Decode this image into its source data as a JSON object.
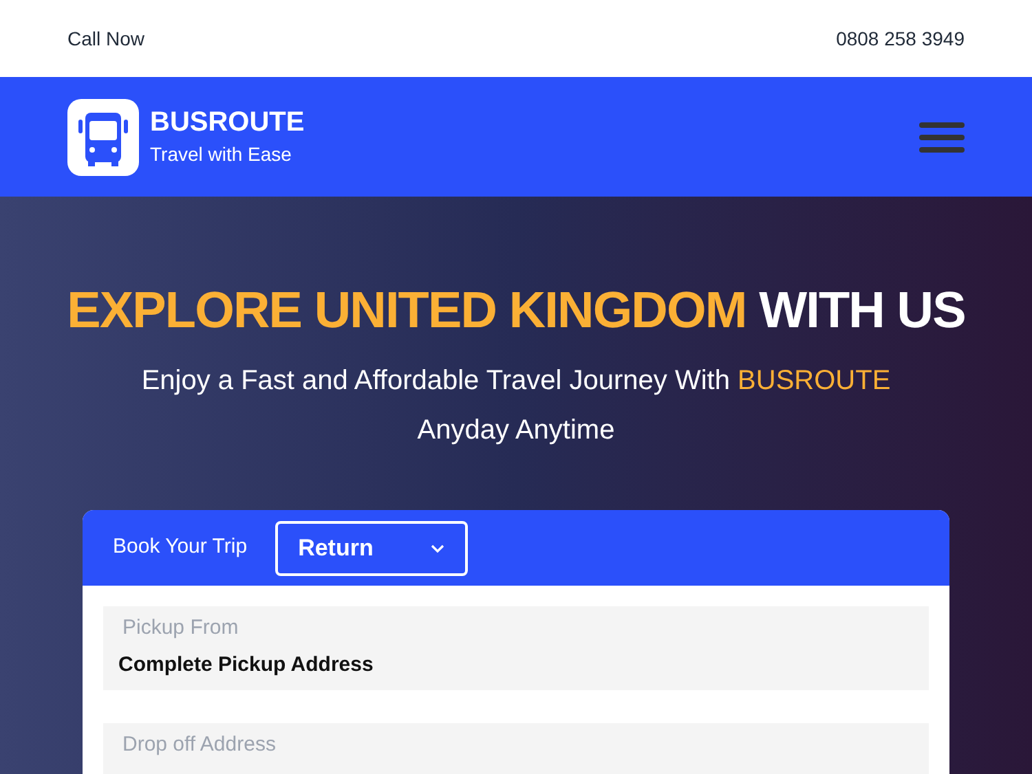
{
  "top_bar": {
    "left": "Call Now",
    "phone": "0808 258 3949"
  },
  "nav": {
    "brand": "BUSROUTE",
    "tagline": "Travel with Ease"
  },
  "hero": {
    "title_highlight": "EXPLORE UNITED KINGDOM",
    "title_rest": "WITH US",
    "subtitle": "Enjoy a Fast and Affordable Travel Journey With",
    "subtitle_brand": "BUSROUTE",
    "subtitle_end": "Anyday Anytime"
  },
  "booking": {
    "label": "Book Your Trip",
    "trip_type": "Return",
    "fields": [
      {
        "label": "Pickup From",
        "placeholder": "Complete Pickup Address"
      },
      {
        "label": "Drop off Address"
      }
    ]
  }
}
